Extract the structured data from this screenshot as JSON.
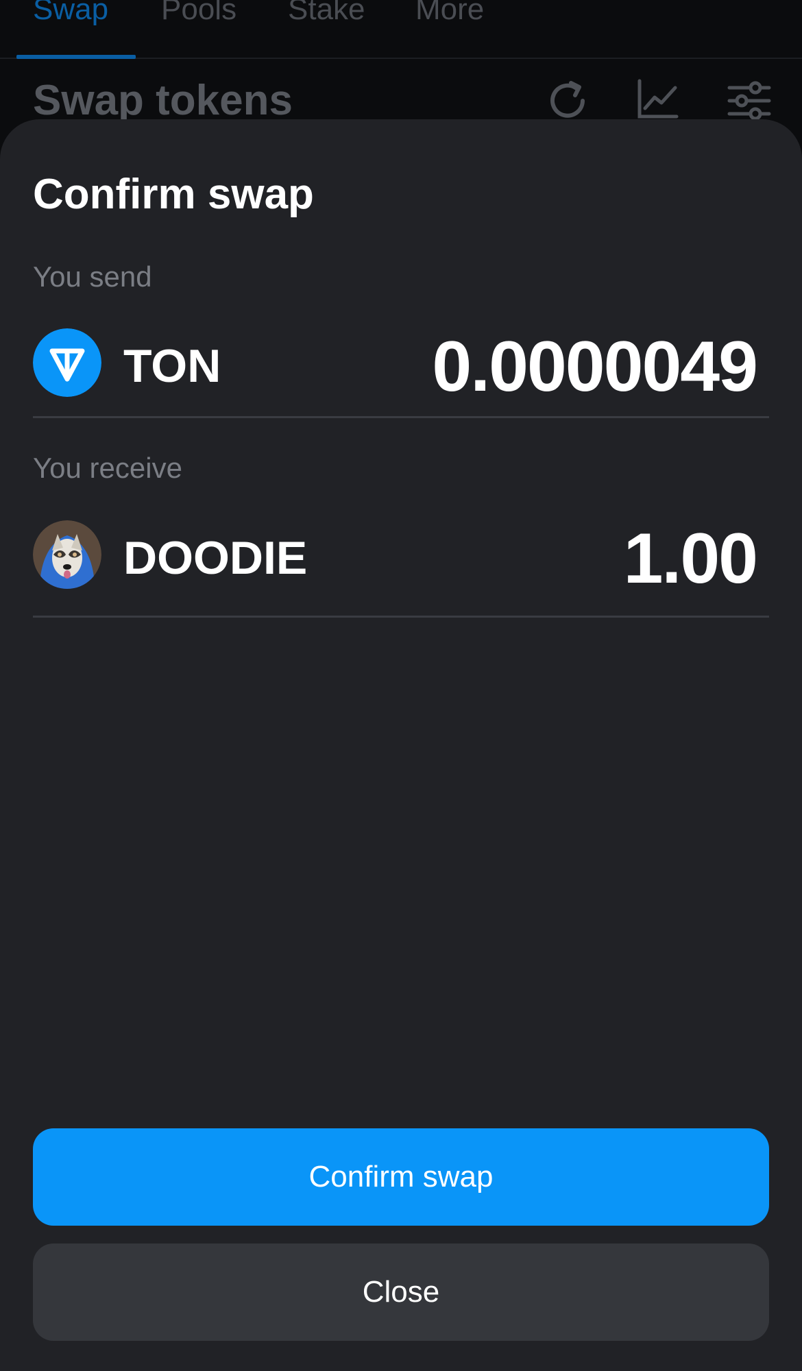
{
  "tabs": [
    {
      "label": "Swap",
      "active": true
    },
    {
      "label": "Pools",
      "active": false
    },
    {
      "label": "Stake",
      "active": false
    },
    {
      "label": "More",
      "active": false
    }
  ],
  "header": {
    "title": "Swap tokens",
    "icons": [
      "refresh-icon",
      "chart-icon",
      "settings-sliders-icon"
    ]
  },
  "sheet": {
    "title": "Confirm swap",
    "send": {
      "label": "You send",
      "symbol": "TON",
      "amount": "0.0000049",
      "icon": "ton-logo-icon"
    },
    "receive": {
      "label": "You receive",
      "symbol": "DOODIE",
      "amount": "1.00",
      "icon": "doodie-logo-icon"
    },
    "confirm_label": "Confirm swap",
    "close_label": "Close"
  },
  "colors": {
    "accent": "#0a95f8",
    "sheet_bg": "#212226",
    "secondary_button": "#35373c"
  }
}
